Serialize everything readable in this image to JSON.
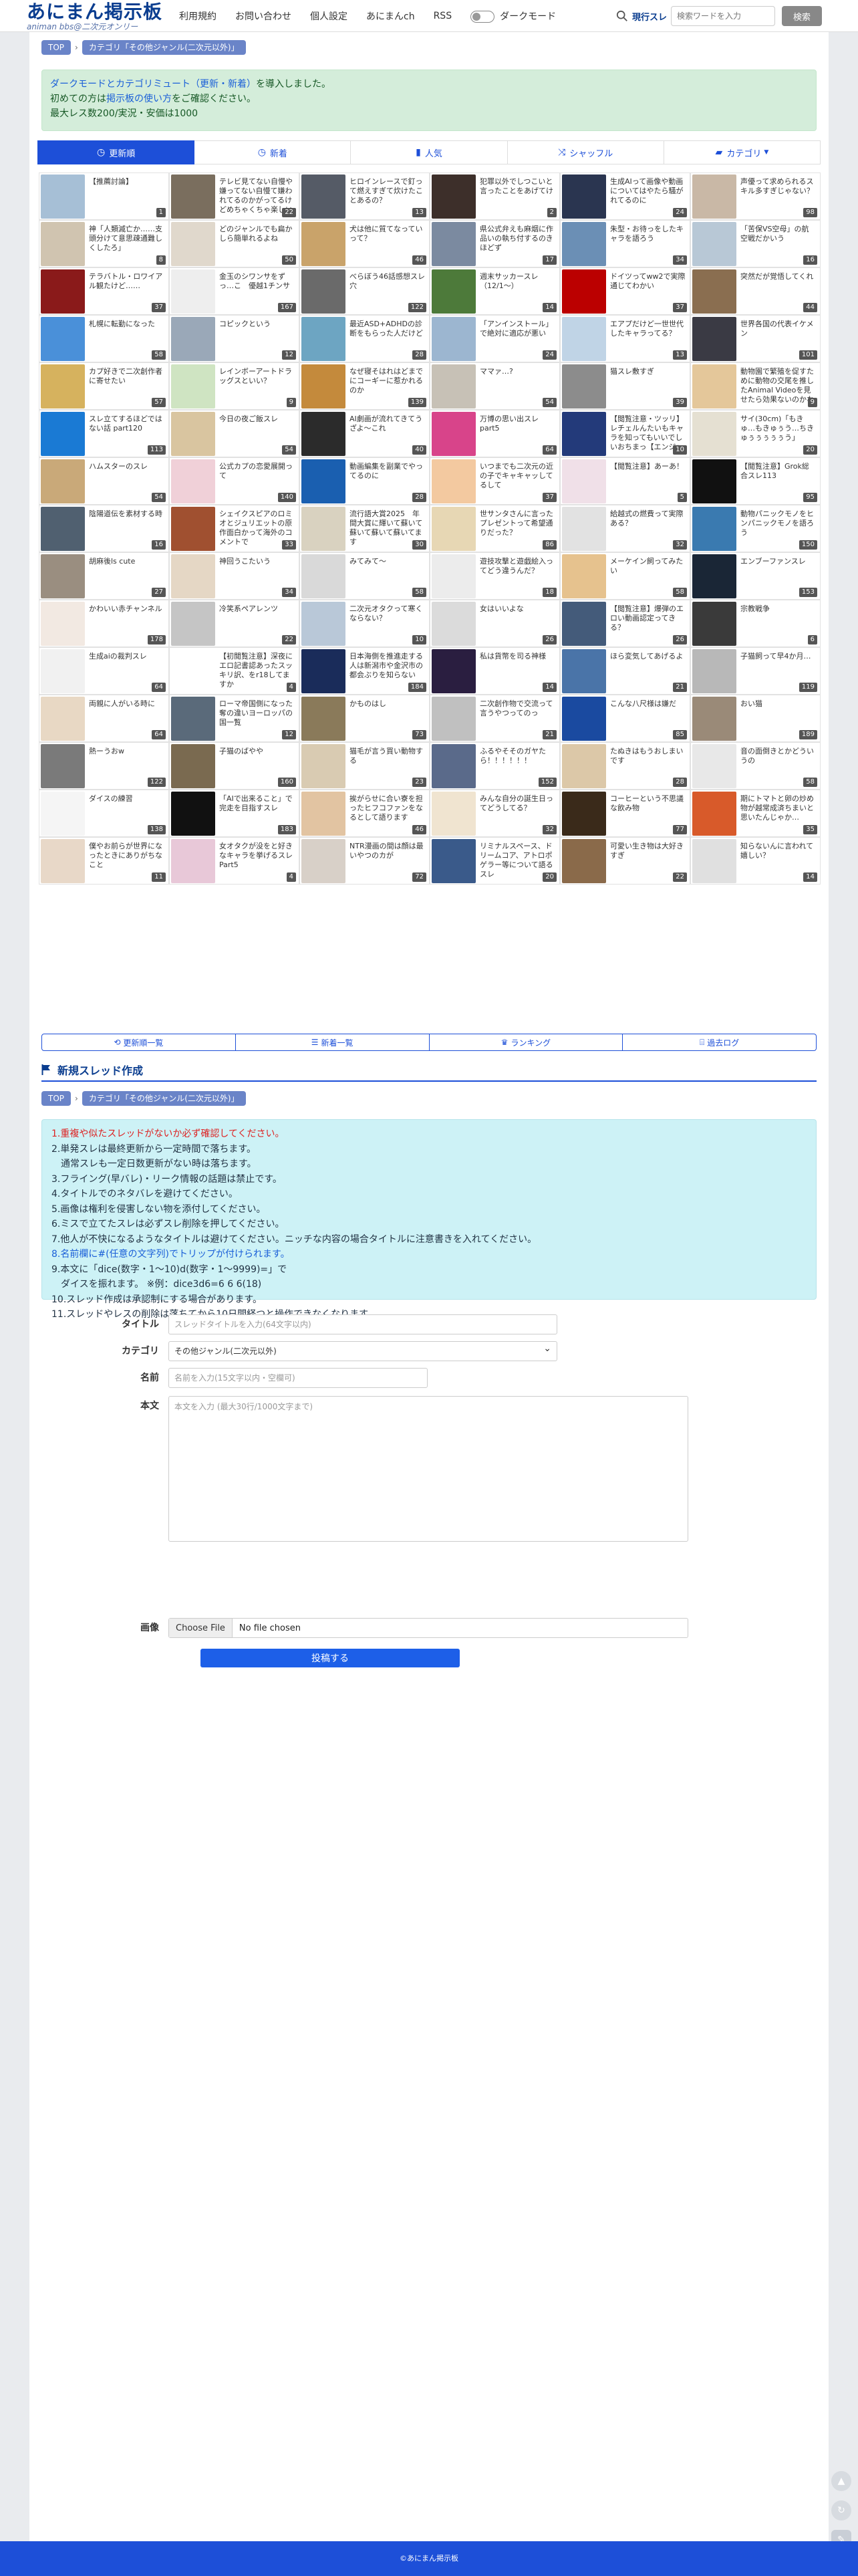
{
  "header": {
    "site_title": "あにまん掲示板",
    "site_subtitle": "animan bbs@二次元オンリー",
    "nav": [
      "利用規約",
      "お問い合わせ",
      "個人設定",
      "あにまんch",
      "RSS"
    ],
    "dark_mode_label": "ダークモード",
    "search_label": "現行スレ",
    "search_placeholder": "検索ワードを入力",
    "search_button": "検索"
  },
  "breadcrumb": {
    "top": "TOP",
    "category": "カテゴリ「その他ジャンル(二次元以外)」"
  },
  "notice": {
    "link1": "ダークモードとカテゴリミュート（更新・新着）",
    "line1_tail": "を導入しました。",
    "line2_pre": "初めての方は",
    "link2": "掲示板の使い方",
    "line2_tail": "をご確認ください。",
    "line3": "最大レス数200/実況・安価は1000"
  },
  "tabs": [
    {
      "label": "更新順",
      "icon": "clock-icon"
    },
    {
      "label": "新着",
      "icon": "clock-icon"
    },
    {
      "label": "人気",
      "icon": "bar-chart-icon"
    },
    {
      "label": "シャッフル",
      "icon": "shuffle-icon"
    },
    {
      "label": "カテゴリ",
      "icon": "folder-icon"
    }
  ],
  "threads": [
    {
      "title": "【推薦討論】",
      "count": "1",
      "color": "#a6bfd6"
    },
    {
      "title": "テレビ見てない自慢や嫌ってない自慢て嫌われてるのかがってるけどめちゃくちゃ楽しいんだよな",
      "count": "22",
      "color": "#7a6e5e"
    },
    {
      "title": "ヒロインレースで釘って燃えすぎて炊けたことあるの？",
      "count": "13",
      "color": "#555b66"
    },
    {
      "title": "犯罪以外でしつこいと言ったことをあげてけ",
      "count": "2",
      "color": "#3d2f2a"
    },
    {
      "title": "生成AIって画像や動画についてはやたら騒がれてるのに",
      "count": "24",
      "color": "#2a3550"
    },
    {
      "title": "声優って求められるスキル多すぎじゃない？",
      "count": "98",
      "color": "#c9b8a6"
    },
    {
      "title": "神「人類滅亡か……支頭分けて意思疎通難しくしたろ」",
      "count": "8",
      "color": "#d0c4b0"
    },
    {
      "title": "どのジャンルでも扁かしら簡単れるよね",
      "count": "50",
      "color": "#e0d8cc"
    },
    {
      "title": "犬は他に質てなっていって？",
      "count": "46",
      "color": "#c9a36a"
    },
    {
      "title": "県公式弁えも麻烟に作品いの執ち付するのきほどず",
      "count": "17",
      "color": "#7b8aa0"
    },
    {
      "title": "朱型・お待っをしたキャラを語ろう",
      "count": "34",
      "color": "#6b8fb5"
    },
    {
      "title": "「苦保VS空母」の航空戦だかいう",
      "count": "16",
      "color": "#b8c8d6"
    },
    {
      "title": "テラバトル・ロワイアル観たけど……",
      "count": "37",
      "color": "#8a1a1a"
    },
    {
      "title": "金玉のシワンサをずっ…こ　優越1チンサ",
      "count": "167",
      "color": "#eeeeee"
    },
    {
      "title": "べらぼう46話感想スレ穴",
      "count": "122",
      "color": "#6a6a6a"
    },
    {
      "title": "週末サッカースレ（12/1～）",
      "count": "14",
      "color": "#4d7a3a"
    },
    {
      "title": "ドイツってww2で実際通じてわかい",
      "count": "37",
      "color": "#bb0000"
    },
    {
      "title": "突然だが覚悟してくれ",
      "count": "44",
      "color": "#8a6e50"
    },
    {
      "title": "札幌に転勤になった",
      "count": "58",
      "color": "#4a90d9"
    },
    {
      "title": "コピックという",
      "count": "12",
      "color": "#9aa8b8"
    },
    {
      "title": "最近ASD+ADHDの診断をもらった人だけど",
      "count": "28",
      "color": "#6da5c2"
    },
    {
      "title": "「アンインストール」で絶対に適応が悪い",
      "count": "24",
      "color": "#9cb6d0"
    },
    {
      "title": "エアプだけど一世世代したキャラってる？",
      "count": "13",
      "color": "#c0d4e6"
    },
    {
      "title": "世界各国の代表イケメン",
      "count": "101",
      "color": "#3a3a44"
    },
    {
      "title": "カプ好きで二次創作者に寄せたい",
      "count": "57",
      "color": "#d6b25e"
    },
    {
      "title": "レインボーアートドラッグスといい？",
      "count": "9",
      "color": "#cfe4c2"
    },
    {
      "title": "なぜ寝そはれはどまでにコーギーに惹かれるのか",
      "count": "139",
      "color": "#c48a3c"
    },
    {
      "title": "ママァ…?",
      "count": "54",
      "color": "#c7c1b6"
    },
    {
      "title": "猫スレ敷すぎ",
      "count": "39",
      "color": "#8c8c8c"
    },
    {
      "title": "動物園で繁殖を促すために動物の交尾を推したAnimal Videoを見せたら効果ないのかな",
      "count": "9",
      "color": "#e4c79a"
    },
    {
      "title": "スレ立てするほどではない話 part120",
      "count": "113",
      "color": "#1a7ad4"
    },
    {
      "title": "今日の夜ご飯スレ",
      "count": "54",
      "color": "#d9c5a0"
    },
    {
      "title": "AI劇画が流れてきてうざよ〜これ",
      "count": "40",
      "color": "#2b2b2b"
    },
    {
      "title": "万博の思い出スレ　part5",
      "count": "64",
      "color": "#d8448a"
    },
    {
      "title": "【閲覧注意・ツッリ】レチェルんたいもキャラを知ってもいいでしいおちまっ【エンジャガ】",
      "count": "10",
      "color": "#233a7a"
    },
    {
      "title": "サイ(30cm)「もきゅ…もきゅぅう…ちきゅぅぅぅぅぅう」",
      "count": "20",
      "color": "#e5e0d2"
    },
    {
      "title": "ハムスターのスレ",
      "count": "54",
      "color": "#c9a979"
    },
    {
      "title": "公式カプの恋愛展開って",
      "count": "140",
      "color": "#f0d0d8"
    },
    {
      "title": "動画編集を副業でやってるのに",
      "count": "28",
      "color": "#1a5fb0"
    },
    {
      "title": "いつまでも二次元の近の子でキャキャッしてるして",
      "count": "37",
      "color": "#f3c9a0"
    },
    {
      "title": "【閲覧注意】あーあ！",
      "count": "5",
      "color": "#f0e0e8"
    },
    {
      "title": "【閲覧注意】Grok総合スレ113",
      "count": "95",
      "color": "#111111"
    },
    {
      "title": "陰陽道伝を素材する時",
      "count": "16",
      "color": "#506070"
    },
    {
      "title": "シェイクスピアのロミオとジュリエットの原作面白かって海外のコメントで",
      "count": "33",
      "color": "#a05030"
    },
    {
      "title": "流行語大賞2025　年間大賞に輝いて蘇いて蘇いて蘇いて蘇いてます",
      "count": "30",
      "color": "#d9d2c0"
    },
    {
      "title": "世サンタさんに言ったプレゼントって希望通りだった？",
      "count": "86",
      "color": "#e7d7b4"
    },
    {
      "title": "給越式の燃費って実際ある？",
      "count": "32",
      "color": "#e2e2e2"
    },
    {
      "title": "動物パニックモノをヒンパニックモノを語ろう",
      "count": "150",
      "color": "#3a7ab0"
    },
    {
      "title": "胡麻後ls cute",
      "count": "27",
      "color": "#9a8e80"
    },
    {
      "title": "神回うこたいう",
      "count": "34",
      "color": "#e5d7c5"
    },
    {
      "title": "みてみて〜",
      "count": "58",
      "color": "#d9d9d9"
    },
    {
      "title": "遊技攻撃と遊戯絵入ってどう違うんだ？",
      "count": "18",
      "color": "#ececec"
    },
    {
      "title": "メーケイン飼ってみたい",
      "count": "58",
      "color": "#e6c28e"
    },
    {
      "title": "エンブーファンスレ",
      "count": "153",
      "color": "#1a2636"
    },
    {
      "title": "かわいい赤チャンネル",
      "count": "178",
      "color": "#f2e9e2"
    },
    {
      "title": "冷笑系ペアレンツ",
      "count": "22",
      "color": "#c5c5c5"
    },
    {
      "title": "二次元オタクって寒くならない？",
      "count": "10",
      "color": "#b9c8d8"
    },
    {
      "title": "女はいいよな",
      "count": "26",
      "color": "#dbdbdb"
    },
    {
      "title": "【閲覧注意】爆弾のエロい動画認定ってきる？",
      "count": "26",
      "color": "#445b7a"
    },
    {
      "title": "宗教戦争",
      "count": "6",
      "color": "#3a3a3a"
    },
    {
      "title": "生成aiの裁判スレ",
      "count": "64",
      "color": "#f1f1f1"
    },
    {
      "title": "【初閲覧注意】深夜にエロ記書認あったスッキリ訳、をr18してますか",
      "count": "4",
      "color": "#ffffff"
    },
    {
      "title": "日本海側を推進走する人は新潟市や金沢市の都会ぶりを知らない",
      "count": "184",
      "color": "#1a2c5a"
    },
    {
      "title": "私は貨幣を司る神様",
      "count": "14",
      "color": "#2a1e40"
    },
    {
      "title": "ほら変気してあげるよ",
      "count": "21",
      "color": "#4a74a8"
    },
    {
      "title": "子猫飼って早4か月…",
      "count": "119",
      "color": "#b8b8b8"
    },
    {
      "title": "両親に人がいる時に",
      "count": "64",
      "color": "#e8d8c4"
    },
    {
      "title": "ローマ帝国側になった奪の違いヨーロッパの国一覧",
      "count": "12",
      "color": "#5a6a7a"
    },
    {
      "title": "かものはし",
      "count": "73",
      "color": "#8a7a5a"
    },
    {
      "title": "二次創作物で交流って言うやつってのっ",
      "count": "21",
      "color": "#c0c0c0"
    },
    {
      "title": "こんな八尺様は嫌だ",
      "count": "85",
      "color": "#1a4aa0"
    },
    {
      "title": "おい猫",
      "count": "189",
      "color": "#9a8a78"
    },
    {
      "title": "熱ーうおw",
      "count": "122",
      "color": "#7a7a7a"
    },
    {
      "title": "子猫のばやや",
      "count": "160",
      "color": "#7a6a50"
    },
    {
      "title": "猫毛が言う買い動物する",
      "count": "23",
      "color": "#d9cbb2"
    },
    {
      "title": "ふるやそそのガヤたら！！！！！！",
      "count": "152",
      "color": "#5a6a8a"
    },
    {
      "title": "たぬきはもうおしまいです",
      "count": "28",
      "color": "#dcc8a8"
    },
    {
      "title": "音の面倒きとかどういうの",
      "count": "58",
      "color": "#e8e8e8"
    },
    {
      "title": "ダイスの練習",
      "count": "138",
      "color": "#f5f5f5"
    },
    {
      "title": "「AIで出来ること」で完走を目指すスレ",
      "count": "183",
      "color": "#111111"
    },
    {
      "title": "挨がらせに合い寮を担ったヒフコファンをなるとして語ります",
      "count": "46",
      "color": "#e2c4a2"
    },
    {
      "title": "みんな自分の誕生日ってどうしてる？",
      "count": "32",
      "color": "#f0e4d0"
    },
    {
      "title": "コーヒーという不思議な飲み物",
      "count": "77",
      "color": "#3a2a1a"
    },
    {
      "title": "期にトマトと卵の炒め物が越常成済ちまいと思いたんじゃか…",
      "count": "35",
      "color": "#d85a2a"
    },
    {
      "title": "僕やお前らが世界になったときにありがちなこと",
      "count": "11",
      "color": "#e8d8c8"
    },
    {
      "title": "女オタクが没をと好きなキャラを挙げるスレ Part5",
      "count": "4",
      "color": "#e8c8d8"
    },
    {
      "title": "NTR漫画の間は顔は最いやつのカが",
      "count": "72",
      "color": "#d8d0c8"
    },
    {
      "title": "リミナルスペース、ドリームコア、アトロポゲラー等について語るスレ",
      "count": "20",
      "color": "#3a5a8a"
    },
    {
      "title": "可愛い生き物は大好きすぎ",
      "count": "22",
      "color": "#8a6a4a"
    },
    {
      "title": "知らないんに言われて嬉しい？",
      "count": "14",
      "color": "#e0e0e0"
    }
  ],
  "links": [
    {
      "label": "更新順一覧",
      "icon": "history-icon"
    },
    {
      "label": "新着一覧",
      "icon": "list-icon"
    },
    {
      "label": "ランキング",
      "icon": "trophy-icon"
    },
    {
      "label": "過去ログ",
      "icon": "archive-icon"
    }
  ],
  "new_thread": {
    "heading": "新規スレッド作成",
    "breadcrumb_top": "TOP",
    "breadcrumb_category": "カテゴリ「その他ジャンル(二次元以外)」"
  },
  "rules": [
    "1.重複や似たスレッドがないか必ず確認してください。",
    "2.単発スレは最終更新から一定時間で落ちます。",
    "　通常スレも一定日数更新がない時は落ちます。",
    "3.フライング(早バレ)・リーク情報の話題は禁止です。",
    "4.タイトルでのネタバレを避けてください。",
    "5.画像は権利を侵害しない物を添付してください。",
    "6.ミスで立てたスレは必ずスレ削除を押してください。",
    "7.他人が不快になるようなタイトルは避けてください。ニッチな内容の場合タイトルに注意書きを入れてください。",
    "8.名前欄に#(任意の文字列)でトリップが付けられます。",
    "9.本文に「dice(数字・1〜10)d(数字・1〜9999)=」で",
    "　ダイスを振れます。 ※例：dice3d6=6 6 6(18)",
    "10.スレッド作成は承認制にする場合があります。",
    "11.スレッドやレスの削除は落ちてから10日間経つと操作できなくなります。"
  ],
  "form": {
    "title_label": "タイトル",
    "title_placeholder": "スレッドタイトルを入力(64文字以内)",
    "category_label": "カテゴリ",
    "category_value": "その他ジャンル(二次元以外)",
    "name_label": "名前",
    "name_placeholder": "名前を入力(15文字以内・空欄可)",
    "body_label": "本文",
    "body_placeholder": "本文を入力 (最大30行/1000文字まで)",
    "image_label": "画像",
    "file_button": "Choose File",
    "file_status": "No file chosen",
    "submit": "投稿する"
  },
  "footer": "©あにまん掲示板"
}
